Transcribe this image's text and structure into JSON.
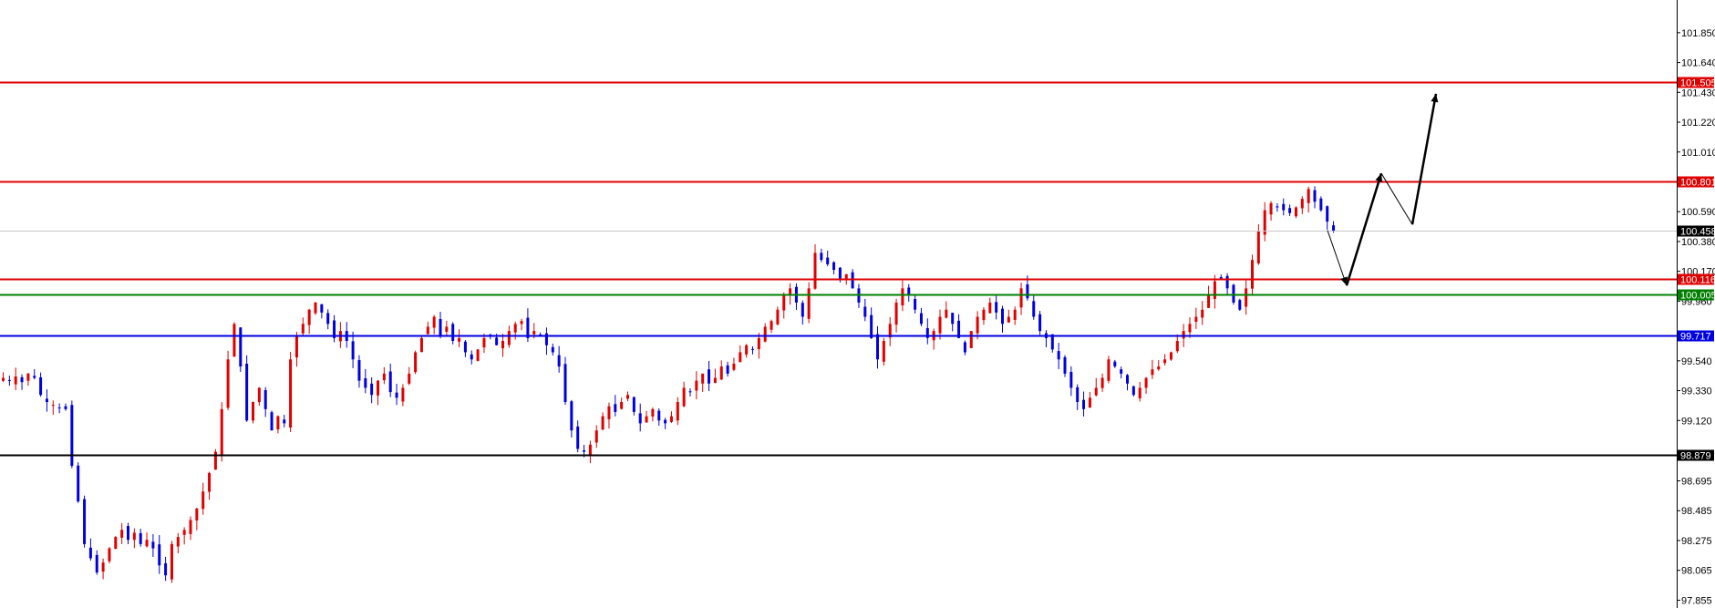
{
  "chart_data": {
    "type": "candlestick",
    "title": "",
    "xlabel": "",
    "ylabel": "",
    "ylim": [
      97.8,
      102.08
    ],
    "y_ticks": [
      "101.850",
      "101.640",
      "101.430",
      "101.220",
      "101.010",
      "100.590",
      "100.380",
      "100.170",
      "99.960",
      "99.540",
      "99.330",
      "99.120",
      "98.695",
      "98.485",
      "98.275",
      "98.065",
      "97.855"
    ],
    "up_color": "#e00000",
    "down_color": "#0000e0",
    "levels": [
      {
        "value": 101.505,
        "label": "101.505",
        "color": "#e00000"
      },
      {
        "value": 100.801,
        "label": "100.801",
        "color": "#e00000"
      },
      {
        "value": 100.458,
        "label": "100.458",
        "color": "#000000",
        "line_color": "#c8c8c8"
      },
      {
        "value": 100.116,
        "label": "100.116",
        "color": "#e00000"
      },
      {
        "value": 100.005,
        "label": "100.005",
        "color": "#008000"
      },
      {
        "value": 99.717,
        "label": "99.717",
        "color": "#0000e0"
      },
      {
        "value": 98.879,
        "label": "98.879",
        "color": "#000000"
      }
    ],
    "close_path": [
      99.42,
      99.4,
      99.43,
      99.39,
      99.45,
      99.42,
      99.3,
      99.25,
      99.23,
      99.21,
      99.2,
      98.8,
      98.55,
      98.25,
      98.15,
      98.05,
      98.12,
      98.22,
      98.3,
      98.35,
      98.28,
      98.33,
      98.25,
      98.28,
      98.22,
      98.1,
      98.03,
      98.25,
      98.3,
      98.35,
      98.42,
      98.5,
      98.62,
      98.75,
      98.9,
      99.2,
      99.55,
      99.8,
      99.5,
      99.12,
      99.25,
      99.35,
      99.2,
      99.05,
      99.15,
      99.1,
      99.55,
      99.72,
      99.8,
      99.9,
      99.95,
      99.88,
      99.8,
      99.7,
      99.75,
      99.68,
      99.55,
      99.4,
      99.35,
      99.3,
      99.4,
      99.45,
      99.32,
      99.28,
      99.35,
      99.45,
      99.6,
      99.7,
      99.78,
      99.85,
      99.72,
      99.78,
      99.68,
      99.7,
      99.6,
      99.55,
      99.62,
      99.7,
      99.72,
      99.65,
      99.68,
      99.75,
      99.8,
      99.82,
      99.7,
      99.75,
      99.72,
      99.65,
      99.6,
      99.5,
      99.25,
      99.05,
      98.92,
      98.9,
      98.95,
      99.05,
      99.15,
      99.22,
      99.18,
      99.25,
      99.3,
      99.18,
      99.1,
      99.15,
      99.2,
      99.12,
      99.1,
      99.15,
      99.25,
      99.35,
      99.32,
      99.4,
      99.45,
      99.38,
      99.42,
      99.5,
      99.45,
      99.52,
      99.6,
      99.65,
      99.62,
      99.7,
      99.78,
      99.82,
      99.9,
      100.0,
      100.05,
      99.95,
      99.85,
      100.05,
      100.3,
      100.25,
      100.22,
      100.18,
      100.12,
      100.15,
      100.05,
      99.95,
      99.85,
      99.7,
      99.55,
      99.68,
      99.8,
      99.95,
      100.05,
      100.0,
      99.9,
      99.8,
      99.7,
      99.75,
      99.85,
      99.9,
      99.8,
      99.7,
      99.6,
      99.75,
      99.85,
      99.9,
      99.95,
      99.88,
      99.8,
      99.85,
      99.9,
      100.05,
      99.98,
      99.85,
      99.75,
      99.7,
      99.62,
      99.55,
      99.45,
      99.35,
      99.25,
      99.2,
      99.28,
      99.35,
      99.42,
      99.55,
      99.5,
      99.45,
      99.38,
      99.3,
      99.35,
      99.42,
      99.48,
      99.5,
      99.55,
      99.6,
      99.68,
      99.75,
      99.8,
      99.85,
      99.9,
      100.0,
      100.1,
      100.12,
      100.05,
      99.95,
      99.9,
      100.05,
      100.25,
      100.45,
      100.6,
      100.65,
      100.62,
      100.6,
      100.58,
      100.62,
      100.68,
      100.75,
      100.66,
      100.6,
      100.52,
      100.45
    ],
    "projection": {
      "points": [
        100.458,
        100.07,
        100.86,
        100.5,
        101.42
      ],
      "color": "#000000"
    }
  }
}
